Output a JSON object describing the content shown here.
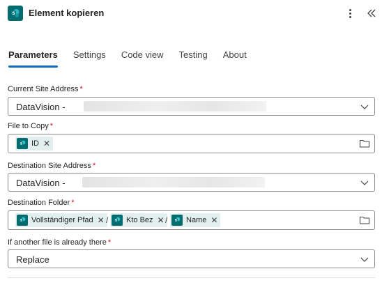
{
  "header": {
    "title": "Element kopieren",
    "icon": "sharepoint-icon",
    "accent": "#036c70"
  },
  "tabs": [
    {
      "label": "Parameters",
      "active": true
    },
    {
      "label": "Settings",
      "active": false
    },
    {
      "label": "Code view",
      "active": false
    },
    {
      "label": "Testing",
      "active": false
    },
    {
      "label": "About",
      "active": false
    }
  ],
  "fields": {
    "current_site": {
      "label": "Current Site Address",
      "required": "*",
      "value": "DataVision -"
    },
    "file_to_copy": {
      "label": "File to Copy",
      "required": "*",
      "tokens": [
        {
          "label": "ID"
        }
      ]
    },
    "destination_site": {
      "label": "Destination Site Address",
      "required": "*",
      "value": "DataVision -"
    },
    "destination_folder": {
      "label": "Destination Folder",
      "required": "*",
      "separator": "/",
      "tokens": [
        {
          "label": "Vollständiger Pfad"
        },
        {
          "label": "Kto Bez"
        },
        {
          "label": "Name"
        }
      ]
    },
    "if_exists": {
      "label": "If another file is already there",
      "required": "*",
      "value": "Replace"
    }
  },
  "colors": {
    "tab_underline": "#0f6cbd",
    "required": "#c50f1f",
    "token_bg": "#e1efee"
  }
}
